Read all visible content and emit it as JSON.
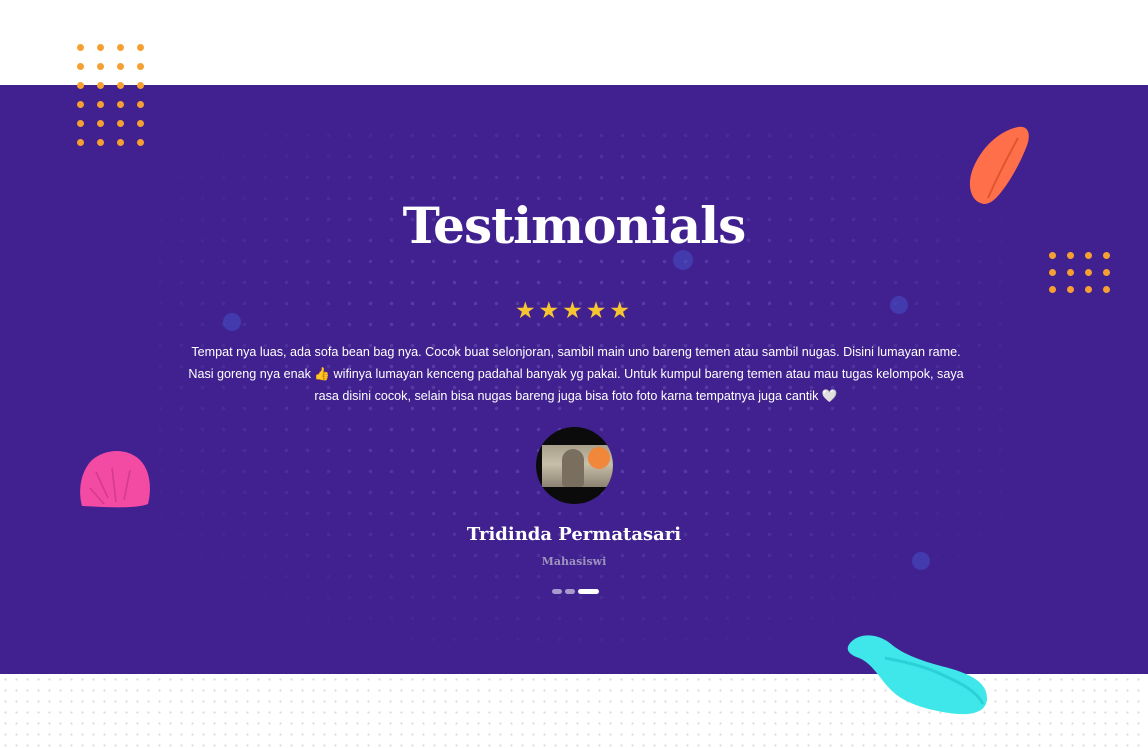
{
  "section": {
    "title": "Testimonials"
  },
  "testimonial": {
    "rating": 5,
    "stars": "★★★★★",
    "review_line1": "Tempat nya luas, ada sofa bean bag nya. Cocok buat selonjoran, sambil main uno bareng temen atau sambil nugas. Disini lumayan rame.",
    "review_line2": "Nasi goreng nya enak 👍 wifinya lumayan kenceng padahal banyak yg pakai. Untuk kumpul bareng temen atau mau tugas kelompok, saya",
    "review_line3": "rasa disini cocok, selain bisa nugas bareng juga bisa foto foto karna tempatnya juga cantik 🤍",
    "name": "Tridinda Permatasari",
    "role": "Mahasiswi"
  },
  "pagination": {
    "count": 3,
    "active_index": 2
  },
  "colors": {
    "band": "#40218f",
    "star": "#f7c531",
    "orange_dots": "#f6a033",
    "leaf": "#ff6f4a",
    "pink_shape": "#f34aa4",
    "cyan_blob": "#3fe7ea"
  }
}
